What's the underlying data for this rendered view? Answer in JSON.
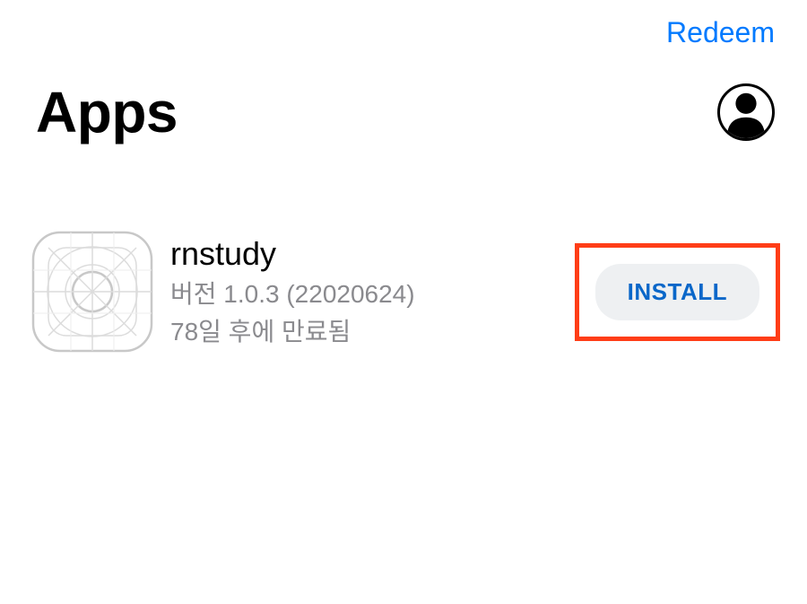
{
  "nav": {
    "redeem_label": "Redeem"
  },
  "header": {
    "title": "Apps"
  },
  "app": {
    "name": "rnstudy",
    "version_line": "버전 1.0.3 (22020624)",
    "expiry_line": "78일 후에 만료됨",
    "install_label": "INSTALL"
  }
}
